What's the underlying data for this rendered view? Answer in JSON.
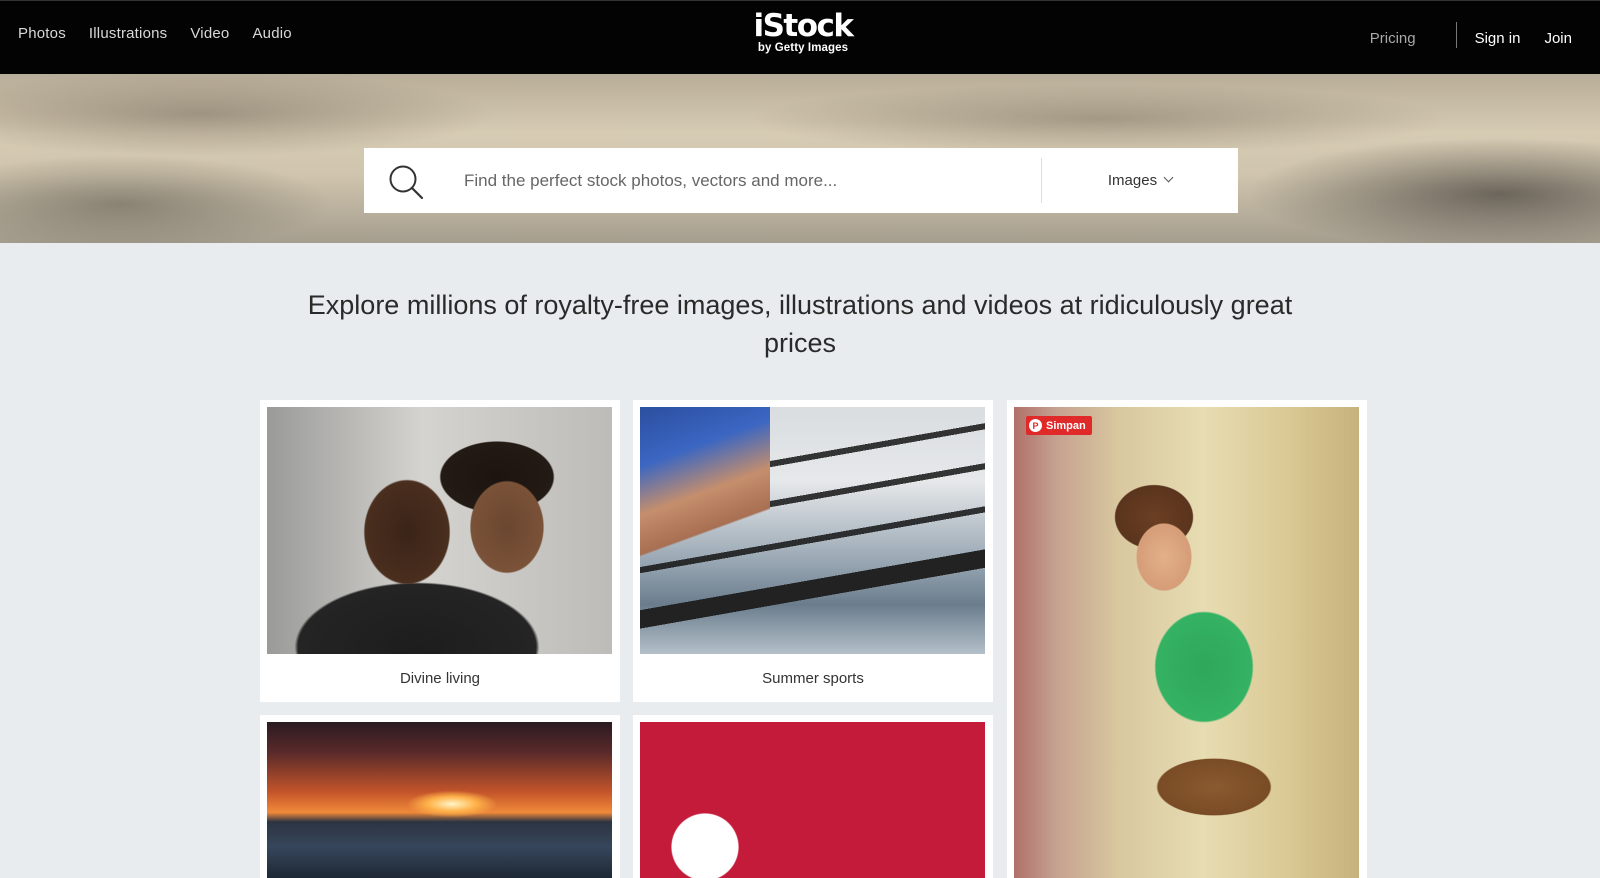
{
  "header": {
    "nav_left": [
      "Photos",
      "Illustrations",
      "Video",
      "Audio"
    ],
    "logo_main": "iStock",
    "logo_sub": "by Getty Images",
    "pricing": "Pricing",
    "sign_in": "Sign in",
    "join": "Join"
  },
  "search": {
    "placeholder": "Find the perfect stock photos, vectors and more...",
    "type_label": "Images"
  },
  "headline": "Explore millions of royalty-free images, illustrations and videos at ridiculously great prices",
  "collections": [
    {
      "caption": "Divine living"
    },
    {
      "caption": "Summer sports"
    }
  ],
  "save_badge": "Simpan",
  "colors": {
    "header_bg": "#030303",
    "page_bg": "#e8ecee",
    "save_red": "#e02a2a"
  }
}
